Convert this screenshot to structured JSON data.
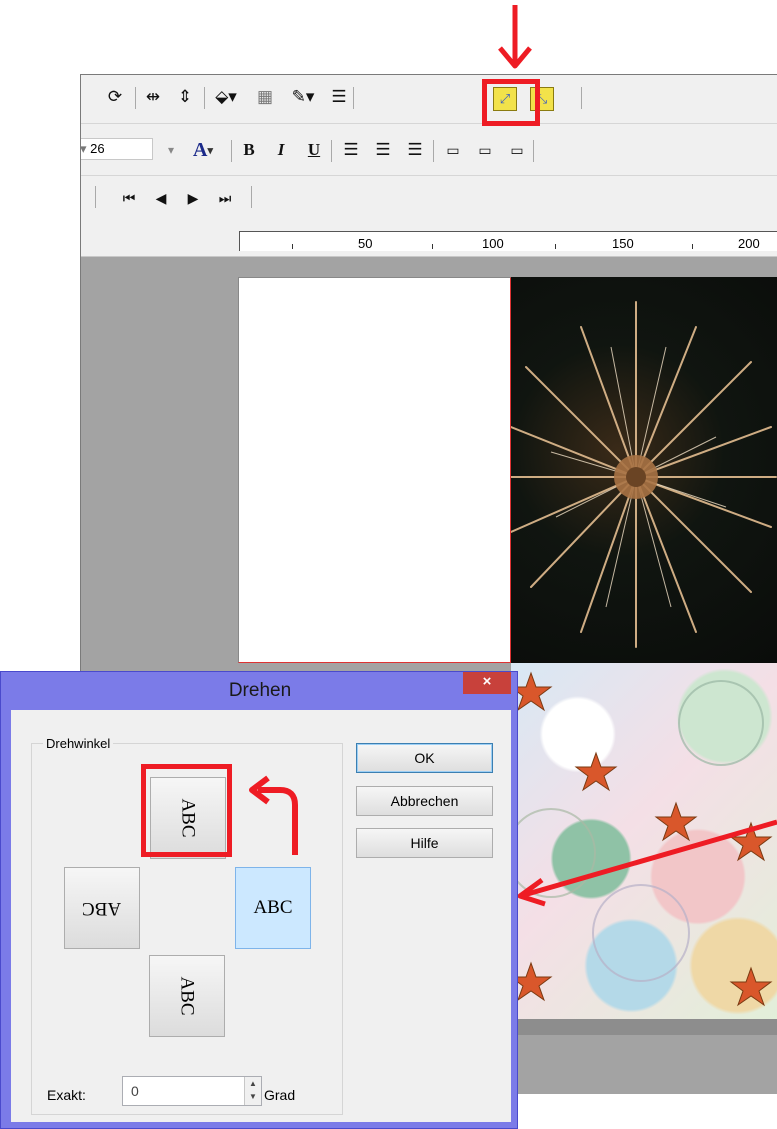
{
  "toolbar": {
    "font_size": "26",
    "font_color_label": "A",
    "bold": "B",
    "italic": "I",
    "underline": "U",
    "first": "⏮",
    "prev": "◀",
    "next": "▶",
    "last": "⏭"
  },
  "ruler": {
    "labels": [
      "50",
      "100",
      "150",
      "200"
    ]
  },
  "dialog": {
    "title": "Drehen",
    "close": "×",
    "group_label": "Drehwinkel",
    "rotate_options": [
      "ABC",
      "ABC",
      "ABC",
      "ABC"
    ],
    "ok": "OK",
    "cancel": "Abbrechen",
    "help": "Hilfe",
    "exact_label": "Exakt:",
    "exact_value": "0",
    "unit": "Grad"
  },
  "colors": {
    "annotation_red": "#ee1c24",
    "dialog_frame": "#7b7be8",
    "selected_button": "#cce8ff"
  }
}
